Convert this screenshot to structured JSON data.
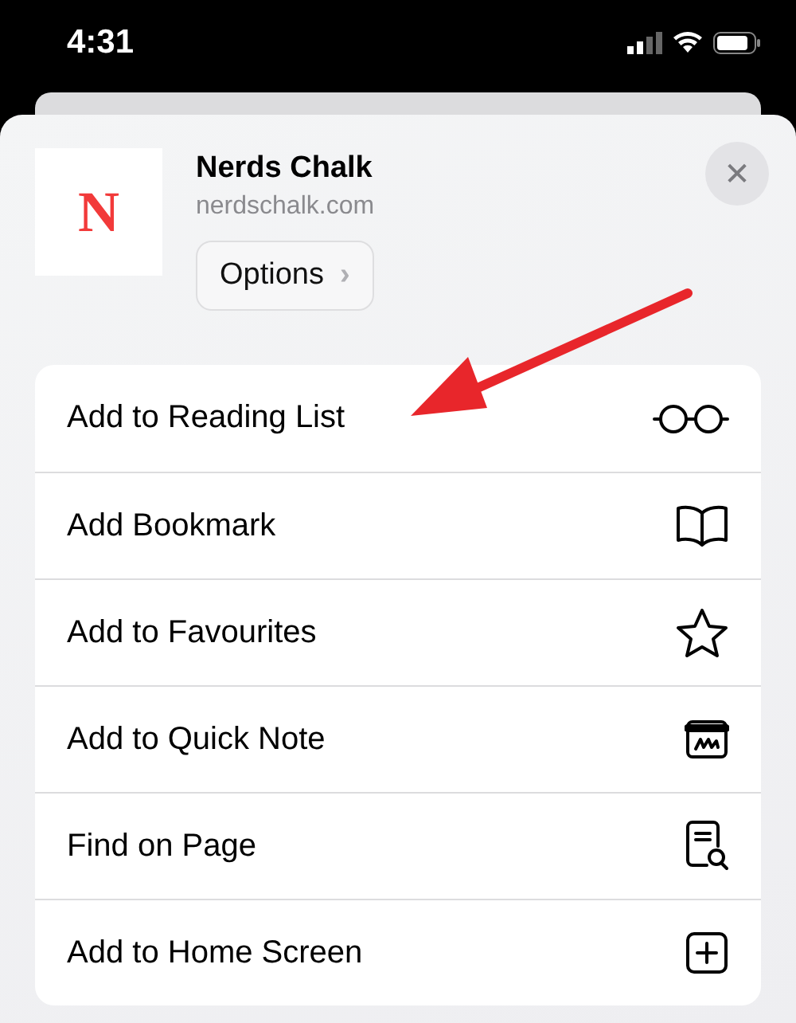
{
  "status_bar": {
    "time": "4:31"
  },
  "site": {
    "logo_letter": "N",
    "title": "Nerds Chalk",
    "url": "nerdschalk.com",
    "options_label": "Options",
    "options_chevron": "›"
  },
  "close_button": {
    "symbol": "✕"
  },
  "actions": [
    {
      "label": "Add to Reading List",
      "kind": "glasses"
    },
    {
      "label": "Add Bookmark",
      "kind": "book"
    },
    {
      "label": "Add to Favourites",
      "kind": "star"
    },
    {
      "label": "Add to Quick Note",
      "kind": "note"
    },
    {
      "label": "Find on Page",
      "kind": "find"
    },
    {
      "label": "Add to Home Screen",
      "kind": "add"
    }
  ],
  "annotation": {
    "kind": "arrow"
  }
}
